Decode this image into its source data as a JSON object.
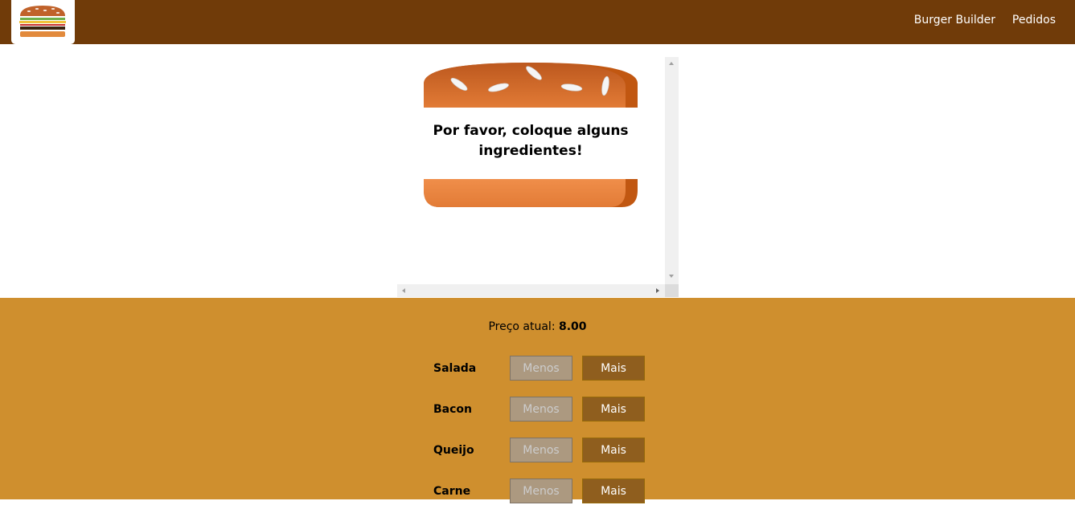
{
  "nav": {
    "items": [
      {
        "label": "Burger Builder"
      },
      {
        "label": "Pedidos"
      }
    ]
  },
  "burger": {
    "empty_message": "Por favor, coloque alguns ingredientes!"
  },
  "controls": {
    "price_label": "Preço atual:",
    "price_value": "8.00",
    "less_label": "Menos",
    "more_label": "Mais",
    "ingredients": [
      {
        "label": "Salada"
      },
      {
        "label": "Bacon"
      },
      {
        "label": "Queijo"
      },
      {
        "label": "Carne"
      }
    ]
  },
  "colors": {
    "toolbar": "#703b09",
    "controls_bg": "#cf8f2e",
    "more_button": "#8f5e1e",
    "less_button_disabled": "#ac9980"
  },
  "icons": {
    "logo": "burger-logo-icon"
  }
}
